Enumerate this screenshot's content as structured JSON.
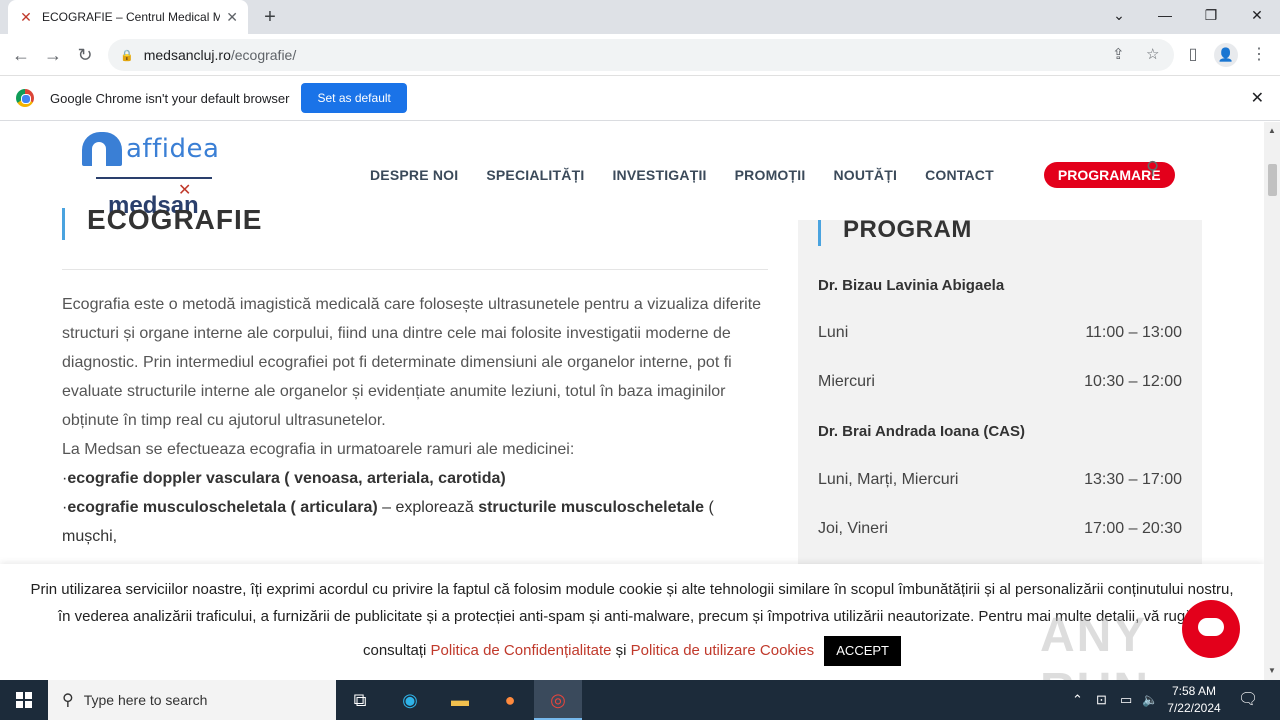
{
  "browser": {
    "tab_title": "ECOGRAFIE – Centrul Medical M",
    "url_host": "medsancluj.ro",
    "url_path": "/ecografie/",
    "infobar_text": "Google Chrome isn't your default browser",
    "set_default_label": "Set as default"
  },
  "site": {
    "logo_affidea": "affidea",
    "logo_medsan": "medsan",
    "nav": [
      "DESPRE NOI",
      "SPECIALITĂȚI",
      "INVESTIGAȚII",
      "PROMOȚII",
      "NOUTĂȚI",
      "CONTACT"
    ],
    "cta": "PROGRAMARE"
  },
  "page": {
    "title": "ECOGRAFIE",
    "intro": "Ecografia este o metodă imagistică medicală care folosește ultrasunetele pentru a vizualiza diferite structuri și organe interne ale corpului, fiind una dintre cele mai folosite investigatii moderne de diagnostic. Prin intermediul ecografiei pot fi determinate dimensiuni ale organelor interne, pot fi evaluate structurile interne ale organelor și evidențiate anumite leziuni, totul în baza imaginilor obținute în timp real cu ajutorul ultrasunetelor.",
    "intro2": "La Medsan se efectueaza ecografia in urmatoarele ramuri ale medicinei:",
    "bullet1": "ecografie doppler vasculara ( venoasa, arteriala, carotida)",
    "bullet2_bold": "ecografie musculoscheletala ( articulara)",
    "bullet2_mid": " – explorează ",
    "bullet2_bold2": "structurile musculoscheletale",
    "bullet2_tail": " ( mușchi,"
  },
  "sidebar": {
    "title": "PROGRAM",
    "doctor1": "Dr. Bizau Lavinia Abigaela",
    "doctor1_rows": [
      {
        "day": "Luni",
        "hours": "11:00 – 13:00"
      },
      {
        "day": "Miercuri",
        "hours": "10:30 – 12:00"
      }
    ],
    "doctor2": "Dr. Brai Andrada Ioana (CAS)",
    "doctor2_rows": [
      {
        "day": "Luni, Marți, Miercuri",
        "hours": "13:30 – 17:00"
      },
      {
        "day": "Joi, Vineri",
        "hours": "17:00 – 20:30"
      }
    ]
  },
  "cookie": {
    "line1": "Prin utilizarea serviciilor noastre, îți exprimi acordul cu privire la faptul că folosim module cookie și alte tehnologii similare în scopul îmbunătățirii și al personalizării conținutului nostru,",
    "line2": "în vederea analizării traficului, a furnizării de publicitate și a protecției anti-spam și anti-malware, precum și împotriva utilizării neautorizate. Pentru mai multe detalii, vă rugăm",
    "line3_prefix": "consultați ",
    "link1": "Politica de Confidențialitate",
    "and": " și ",
    "link2": "Politica de utilizare Cookies",
    "accept": "ACCEPT"
  },
  "watermark": "ANY RUN",
  "taskbar": {
    "search_placeholder": "Type here to search",
    "time": "7:58 AM",
    "date": "7/22/2024"
  }
}
